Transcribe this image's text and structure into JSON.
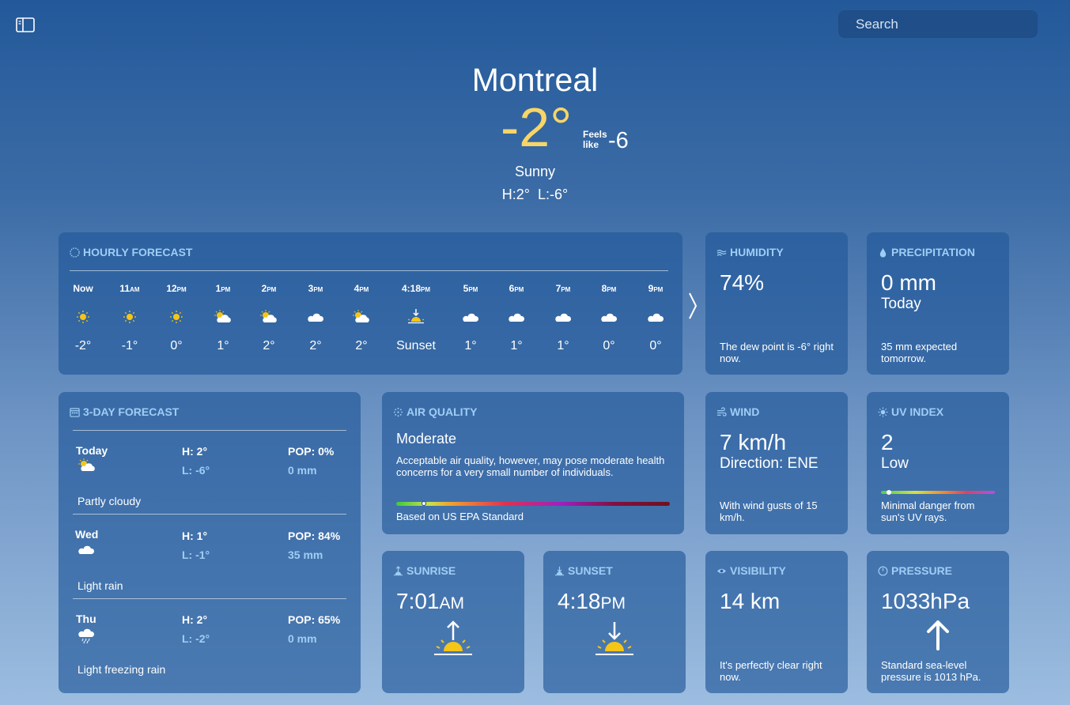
{
  "search": {
    "placeholder": "Search"
  },
  "current": {
    "city": "Montreal",
    "temp": "-2°",
    "feels_label": "Feels like",
    "feels_value": "-6",
    "condition": "Sunny",
    "hilo": "H:2°  L:-6°"
  },
  "hourly": {
    "title": "HOURLY FORECAST",
    "hours": [
      {
        "time": "Now",
        "suffix": "",
        "icon": "sun-icon",
        "temp": "-2°"
      },
      {
        "time": "11",
        "suffix": "AM",
        "icon": "sun-icon",
        "temp": "-1°"
      },
      {
        "time": "12",
        "suffix": "PM",
        "icon": "sun-icon",
        "temp": "0°"
      },
      {
        "time": "1",
        "suffix": "PM",
        "icon": "partly-cloudy-icon",
        "temp": "1°"
      },
      {
        "time": "2",
        "suffix": "PM",
        "icon": "partly-cloudy-icon",
        "temp": "2°"
      },
      {
        "time": "3",
        "suffix": "PM",
        "icon": "cloud-icon",
        "temp": "2°"
      },
      {
        "time": "4",
        "suffix": "PM",
        "icon": "partly-cloudy-icon",
        "temp": "2°"
      },
      {
        "time": "4:18",
        "suffix": "PM",
        "icon": "sunset-icon",
        "temp": "Sunset"
      },
      {
        "time": "5",
        "suffix": "PM",
        "icon": "cloud-icon",
        "temp": "1°"
      },
      {
        "time": "6",
        "suffix": "PM",
        "icon": "cloud-icon",
        "temp": "1°"
      },
      {
        "time": "7",
        "suffix": "PM",
        "icon": "cloud-icon",
        "temp": "1°"
      },
      {
        "time": "8",
        "suffix": "PM",
        "icon": "cloud-icon",
        "temp": "0°"
      },
      {
        "time": "9",
        "suffix": "PM",
        "icon": "cloud-icon",
        "temp": "0°"
      }
    ]
  },
  "humidity": {
    "title": "HUMIDITY",
    "value": "74%",
    "note": "The dew point is -6° right now."
  },
  "precipitation": {
    "title": "PRECIPITATION",
    "value": "0 mm",
    "sub": "Today",
    "note": "35 mm expected tomorrow."
  },
  "forecast3": {
    "title": "3-DAY FORECAST",
    "days": [
      {
        "day": "Today",
        "icon": "partly-cloudy-icon",
        "hi": "H: 2°",
        "lo": "L: -6°",
        "pop": "POP: 0%",
        "mm": "0 mm",
        "desc": "Partly cloudy"
      },
      {
        "day": "Wed",
        "icon": "cloud-icon",
        "hi": "H: 1°",
        "lo": "L: -1°",
        "pop": "POP: 84%",
        "mm": "35 mm",
        "desc": "Light rain"
      },
      {
        "day": "Thu",
        "icon": "freezing-rain-icon",
        "hi": "H: 2°",
        "lo": "L: -2°",
        "pop": "POP: 65%",
        "mm": "0 mm",
        "desc": "Light freezing rain"
      }
    ]
  },
  "air_quality": {
    "title": "AIR QUALITY",
    "level": "Moderate",
    "description": "Acceptable air quality, however, may pose moderate health concerns for a very small number of individuals.",
    "standard": "Based on US EPA Standard",
    "scale_position": 0.1
  },
  "wind": {
    "title": "WIND",
    "value": "7 km/h",
    "direction": "Direction: ENE",
    "note": "With wind gusts of 15 km/h."
  },
  "uv": {
    "title": "UV INDEX",
    "value": "2",
    "level": "Low",
    "note": "Minimal danger from sun's UV rays.",
    "scale_position": 0.07
  },
  "sunrise": {
    "title": "SUNRISE",
    "time": "7:01",
    "suffix": "AM"
  },
  "sunset": {
    "title": "SUNSET",
    "time": "4:18",
    "suffix": "PM"
  },
  "visibility": {
    "title": "VISIBILITY",
    "value": "14 km",
    "note": "It's perfectly clear right now."
  },
  "pressure": {
    "title": "PRESSURE",
    "value": "1033hPa",
    "note": "Standard sea-level pressure is 1013 hPa."
  },
  "colors": {
    "temp": "#f7d566",
    "accent": "#9fcdf5",
    "sun": "#f5c518"
  }
}
